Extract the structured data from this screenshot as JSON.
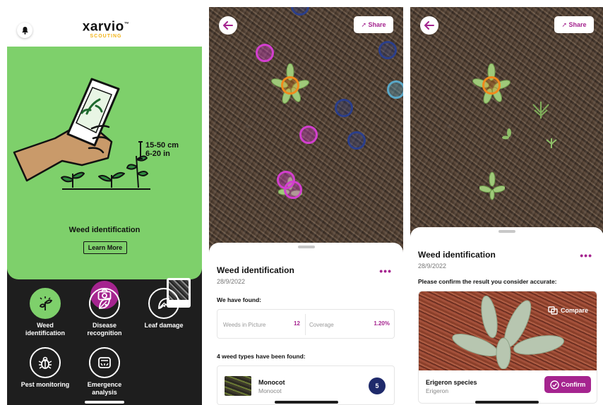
{
  "screen1": {
    "logo": {
      "name": "xarvio",
      "trademark": "™",
      "sub": "SCOUTING"
    },
    "range": {
      "line1": "15-50 cm",
      "line2": "6-20 in"
    },
    "feature_title": "Weed identification",
    "learn_more_label": "Learn More",
    "nav": [
      {
        "label1": "Weed",
        "label2": "identification",
        "icon": "weed-sprout-icon",
        "active": true
      },
      {
        "label1": "Disease",
        "label2": "recognition",
        "icon": "leaf-disease-icon"
      },
      {
        "label1": "Leaf damage",
        "label2": "",
        "icon": "leaf-damage-icon"
      },
      {
        "label1": "Pest monitoring",
        "label2": "",
        "icon": "bug-icon"
      },
      {
        "label1": "Emergence",
        "label2": "analysis",
        "icon": "emergence-icon"
      }
    ],
    "colors": {
      "green": "#7ed06b",
      "accent": "#a5248f",
      "dark": "#1e1e1e"
    }
  },
  "screen2": {
    "share_label": "Share",
    "title": "Weed identification",
    "date": "28/9/2022",
    "found_label": "We have found:",
    "stats": {
      "weeds_label": "Weeds in Picture",
      "weeds_value": "12",
      "coverage_label": "Coverage",
      "coverage_value": "1.20%"
    },
    "types_label": "4 weed types have been found:",
    "result": {
      "title": "Monocot",
      "subtitle": "Monocot",
      "count": "5"
    },
    "more_label": "•••",
    "marker_colors": {
      "magenta": "#d33fcf",
      "navy": "#2b3f8c",
      "orange": "#f08a1c",
      "teal": "#5aa8c8"
    }
  },
  "screen3": {
    "share_label": "Share",
    "title": "Weed identification",
    "date": "28/9/2022",
    "confirm_prompt": "Please confirm the result you consider accurate:",
    "compare_label": "Compare",
    "species": "Erigeron species",
    "genus": "Erigeron",
    "confirm_label": "Confirm",
    "more_label": "•••"
  }
}
